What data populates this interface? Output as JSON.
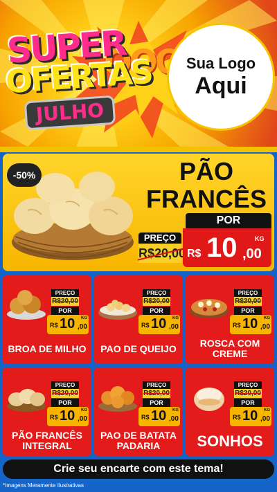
{
  "header": {
    "brand_line1": "SUPER",
    "brand_line2": "OFERTAS",
    "brand_line3": "JULHO",
    "logo_line1": "Sua Logo",
    "logo_line2": "Aqui"
  },
  "hero": {
    "badge": "-50%",
    "title_line1": "PÃO",
    "title_line2": "FRANCÊS",
    "preco_label": "PREÇO",
    "old_price": "R$20,00",
    "por_label": "POR",
    "currency": "R$",
    "price_int": "10",
    "price_dec": ",00",
    "unit": "KG"
  },
  "products": [
    {
      "name": "BROA DE MILHO",
      "preco_label": "PREÇO",
      "old_price": "R$20,00",
      "por_label": "POR",
      "currency": "R$",
      "price_int": "10",
      "price_dec": ",00",
      "unit": "KG"
    },
    {
      "name": "PAO DE QUEIJO",
      "preco_label": "PREÇO",
      "old_price": "R$20,00",
      "por_label": "POR",
      "currency": "R$",
      "price_int": "10",
      "price_dec": ",00",
      "unit": "KG"
    },
    {
      "name": "ROSCA COM CREME",
      "preco_label": "PREÇO",
      "old_price": "R$20,00",
      "por_label": "POR",
      "currency": "R$",
      "price_int": "10",
      "price_dec": ",00",
      "unit": "KG"
    },
    {
      "name": "PÃO FRANCÊS INTEGRAL",
      "preco_label": "PREÇO",
      "old_price": "R$20,00",
      "por_label": "POR",
      "currency": "R$",
      "price_int": "10",
      "price_dec": ",00",
      "unit": "KG"
    },
    {
      "name": "PAO DE BATATA PADARIA",
      "preco_label": "PREÇO",
      "old_price": "R$20,00",
      "por_label": "POR",
      "currency": "R$",
      "price_int": "10",
      "price_dec": ",00",
      "unit": "KG"
    },
    {
      "name": "SONHOS",
      "preco_label": "PREÇO",
      "old_price": "R$20,00",
      "por_label": "POR",
      "currency": "R$",
      "price_int": "10",
      "price_dec": ",00",
      "unit": "KG"
    }
  ],
  "footer": {
    "cta": "Crie seu encarte com este tema!",
    "disclaimer": "*Imagens Meramente Ilustrativas"
  },
  "colors": {
    "accent_yellow": "#f7b500",
    "card_red": "#e31b1b",
    "background_blue": "#1565c8"
  }
}
